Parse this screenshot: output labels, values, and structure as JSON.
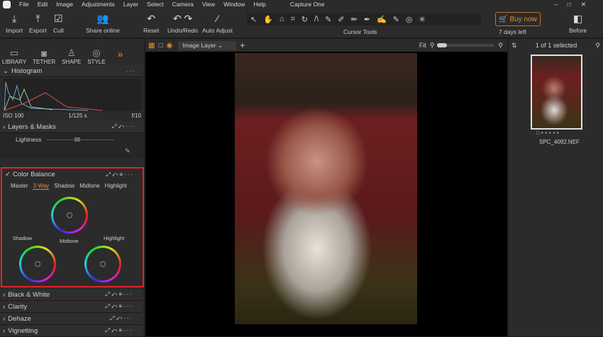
{
  "menu": {
    "items": [
      "File",
      "Edit",
      "Image",
      "Adjustments",
      "Layer",
      "Select",
      "Camera",
      "View",
      "Window",
      "Help"
    ],
    "app_title": "Capture One"
  },
  "toolbar": {
    "import": "Import",
    "export": "Export",
    "cull": "Cull",
    "share": "Share online",
    "reset": "Reset",
    "undo": "Undo/Redo",
    "auto": "Auto Adjust",
    "cursor_tools": "Cursor Tools",
    "buy": "Buy now",
    "trial": "7 days left",
    "before": "Before"
  },
  "left": {
    "tabs": [
      "LIBRARY",
      "TETHER",
      "SHAPE",
      "STYLE"
    ],
    "histogram": "Histogram",
    "iso": "ISO 100",
    "shutter": "1/125 s",
    "aperture": "f/10",
    "layers": "Layers & Masks",
    "lightness": "Lightness",
    "color_balance": {
      "title": "Color Balance",
      "tabs": [
        "Master",
        "3-Way",
        "Shadow",
        "Midtone",
        "Highlight"
      ],
      "active_tab": "3-Way",
      "shadow": "Shadow",
      "midtone": "Midtone",
      "highlight": "Highlight"
    },
    "sections": [
      "Black & White",
      "Clarity",
      "Dehaze",
      "Vignetting"
    ]
  },
  "viewer": {
    "layer": "Image Layer",
    "fit": "Fit"
  },
  "browser": {
    "count": "1 of 1 selected",
    "filename": "SPC_4092.NEF"
  },
  "colors": {
    "accent": "#e58f2a",
    "highlight_box": "#e0242b"
  }
}
